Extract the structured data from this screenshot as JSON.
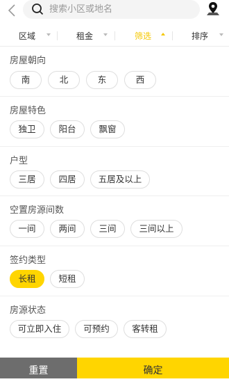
{
  "search": {
    "placeholder": "搜索小区或地名"
  },
  "filters": {
    "tabs": [
      {
        "label": "区域"
      },
      {
        "label": "租金"
      },
      {
        "label": "筛选"
      },
      {
        "label": "排序"
      }
    ]
  },
  "sections": [
    {
      "title": "房屋朝向",
      "options": [
        "南",
        "北",
        "东",
        "西"
      ]
    },
    {
      "title": "房屋特色",
      "options": [
        "独卫",
        "阳台",
        "飘窗"
      ]
    },
    {
      "title": "户型",
      "options": [
        "三居",
        "四居",
        "五居及以上"
      ]
    },
    {
      "title": "空置房源间数",
      "options": [
        "一间",
        "两间",
        "三间",
        "三间以上"
      ]
    },
    {
      "title": "签约类型",
      "options": [
        "长租",
        "短租"
      ]
    },
    {
      "title": "房源状态",
      "options": [
        "可立即入住",
        "可预约",
        "客转租"
      ]
    }
  ],
  "buttons": {
    "reset": "重置",
    "confirm": "确定"
  },
  "colors": {
    "accent": "#ffd500",
    "reset_bg": "#6d6d6d"
  }
}
